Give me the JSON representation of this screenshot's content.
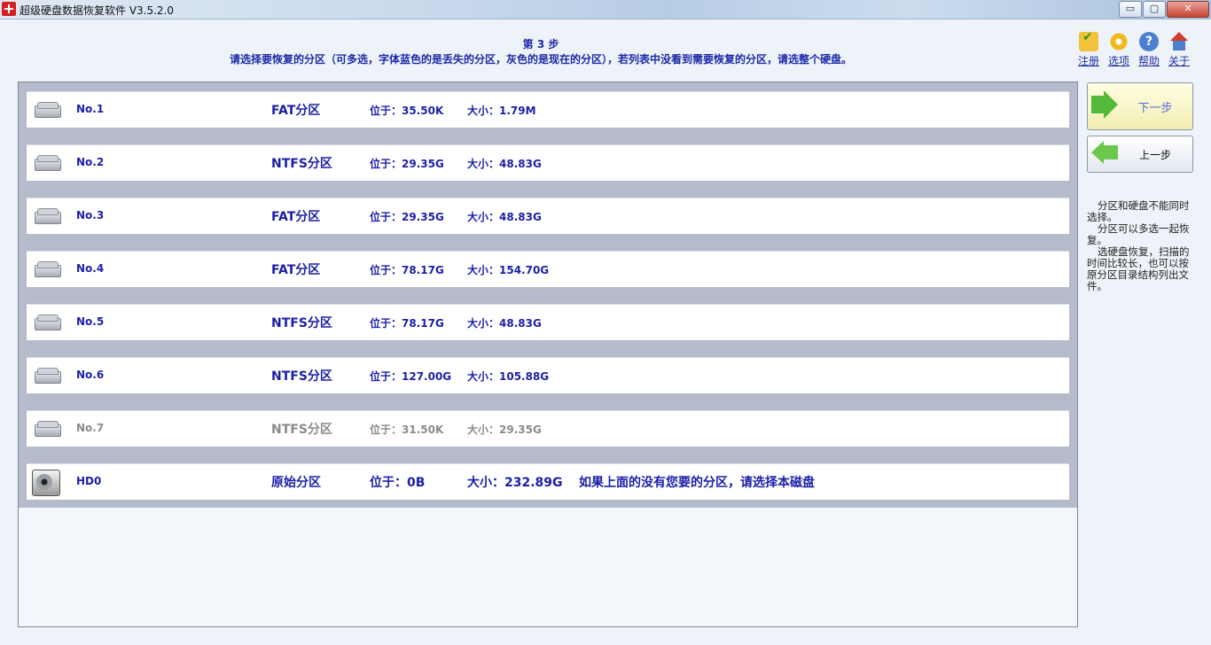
{
  "window": {
    "title": "超级硬盘数据恢复软件 V3.5.2.0",
    "controls": {
      "minimize": "▭",
      "maximize": "▢",
      "close": "✕"
    }
  },
  "header": {
    "step": "第 3 步",
    "instruction": "请选择要恢复的分区（可多选，字体蓝色的是丢失的分区，灰色的是现在的分区），若列表中没看到需要恢复的分区，请选整个硬盘。"
  },
  "toolbar": [
    {
      "label": "注册",
      "icon": "cart-check-icon"
    },
    {
      "label": "选项",
      "icon": "gear-icon"
    },
    {
      "label": "帮助",
      "icon": "help-icon"
    },
    {
      "label": "关于",
      "icon": "home-icon"
    }
  ],
  "colors": {
    "lost_partition": "#1a1fa8",
    "current_partition": "#8a8a8a"
  },
  "partitions": [
    {
      "name": "No.1",
      "type": "FAT分区",
      "position": "位于：35.50K",
      "size": "大小：1.79M",
      "status": "lost"
    },
    {
      "name": "No.2",
      "type": "NTFS分区",
      "position": "位于：29.35G",
      "size": "大小：48.83G",
      "status": "lost"
    },
    {
      "name": "No.3",
      "type": "FAT分区",
      "position": "位于：29.35G",
      "size": "大小：48.83G",
      "status": "lost"
    },
    {
      "name": "No.4",
      "type": "FAT分区",
      "position": "位于：78.17G",
      "size": "大小：154.70G",
      "status": "lost"
    },
    {
      "name": "No.5",
      "type": "NTFS分区",
      "position": "位于：78.17G",
      "size": "大小：48.83G",
      "status": "lost"
    },
    {
      "name": "No.6",
      "type": "NTFS分区",
      "position": "位于：127.00G",
      "size": "大小：105.88G",
      "status": "lost"
    },
    {
      "name": "No.7",
      "type": "NTFS分区",
      "position": "位于：31.50K",
      "size": "大小：29.35G",
      "status": "current"
    },
    {
      "name": "HD0",
      "type": "原始分区",
      "position": "位于：0B",
      "size": "大小：232.89G",
      "status": "disk",
      "note": "如果上面的没有您要的分区，请选择本磁盘"
    }
  ],
  "buttons": {
    "next": "下一步",
    "prev": "上一步"
  },
  "help": [
    "分区和硬盘不能同时选择。",
    "分区可以多选一起恢复。",
    "选硬盘恢复，扫描的时间比较长，也可以按原分区目录结构列出文件。"
  ]
}
